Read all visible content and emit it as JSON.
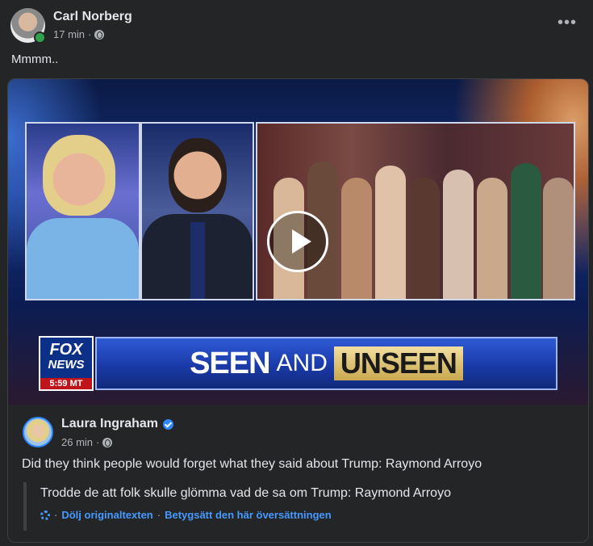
{
  "post": {
    "author": "Carl Norberg",
    "time": "17 min",
    "separator": "·",
    "more": "•••",
    "text": "Mmmm.."
  },
  "shared": {
    "video": {
      "banner_seen": "SEEN",
      "banner_and": "AND",
      "banner_unseen": "UNSEEN",
      "logo_fox": "FOX",
      "logo_news": "NEWS",
      "logo_time": "5:59 MT"
    },
    "source": {
      "author": "Laura Ingraham",
      "time": "26 min",
      "separator": "·"
    },
    "caption": "Did they think people would forget what they said about Trump: Raymond Arroyo",
    "translation": {
      "text": "Trodde de att folk skulle glömma vad de sa om Trump: Raymond Arroyo",
      "sep1": "·",
      "hide_label": "Dölj originaltexten",
      "sep2": "·",
      "rate_label": "Betygsätt den här översättningen"
    }
  },
  "colors": {
    "background": "#242526",
    "text": "#e4e6eb",
    "secondary": "#b0b3b8",
    "link": "#4599ff",
    "online": "#31a24c",
    "verified": "#2d88ff"
  },
  "icons": [
    "globe-icon",
    "more-icon",
    "play-icon",
    "verified-icon",
    "gear-icon"
  ]
}
